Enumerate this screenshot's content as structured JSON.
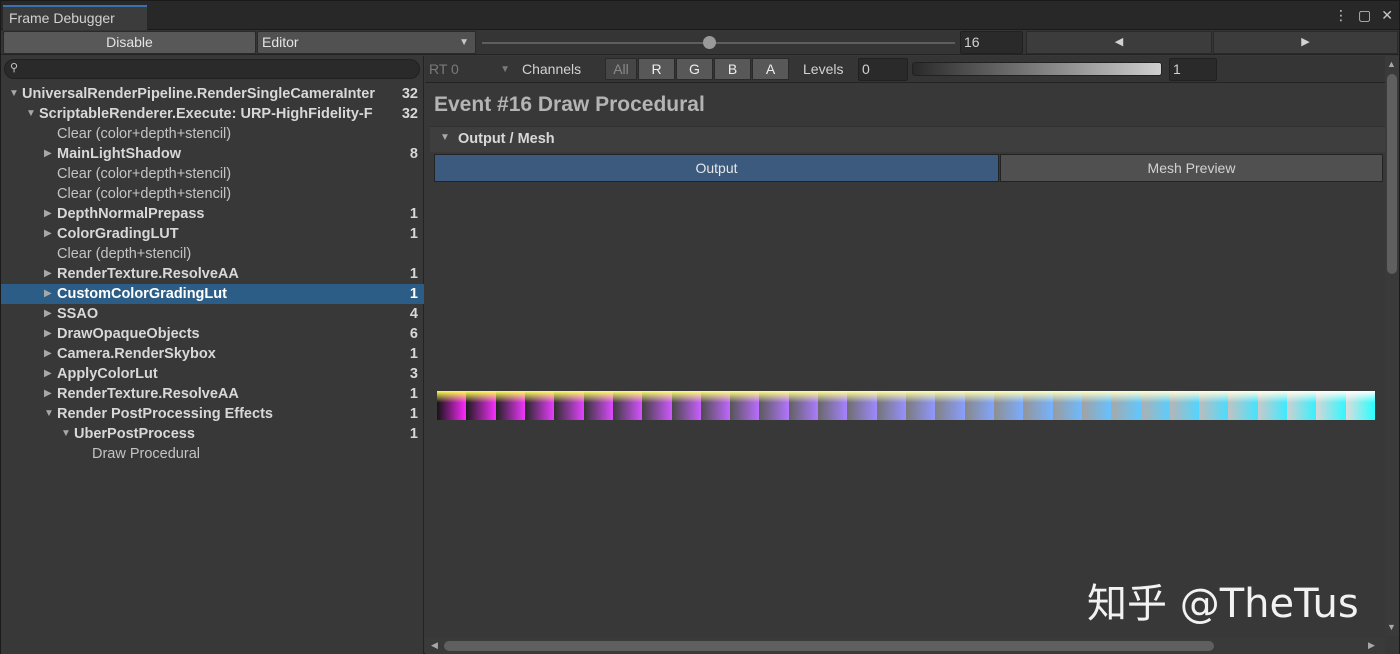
{
  "window": {
    "tab_title": "Frame Debugger",
    "menu_icon": "kebab-menu-icon",
    "maximize_icon": "maximize-icon",
    "close_icon": "close-icon"
  },
  "toolbar": {
    "disable_label": "Disable",
    "target_value": "Editor",
    "event_index": "16",
    "event_slider_fraction": 0.48
  },
  "search": {
    "placeholder": "",
    "icon": "search-icon"
  },
  "tree": [
    {
      "label": "UniversalRenderPipeline.RenderSingleCameraInter",
      "count": "32",
      "depth": 0,
      "expanded": true,
      "bold": true
    },
    {
      "label": "ScriptableRenderer.Execute: URP-HighFidelity-F",
      "count": "32",
      "depth": 1,
      "expanded": true,
      "bold": true
    },
    {
      "label": "Clear (color+depth+stencil)",
      "count": "",
      "depth": 2,
      "leaf": true
    },
    {
      "label": "MainLightShadow",
      "count": "8",
      "depth": 2,
      "expanded": false,
      "bold": true
    },
    {
      "label": "Clear (color+depth+stencil)",
      "count": "",
      "depth": 2,
      "leaf": true
    },
    {
      "label": "Clear (color+depth+stencil)",
      "count": "",
      "depth": 2,
      "leaf": true
    },
    {
      "label": "DepthNormalPrepass",
      "count": "1",
      "depth": 2,
      "expanded": false,
      "bold": true
    },
    {
      "label": "ColorGradingLUT",
      "count": "1",
      "depth": 2,
      "expanded": false,
      "bold": true
    },
    {
      "label": "Clear (depth+stencil)",
      "count": "",
      "depth": 2,
      "leaf": true
    },
    {
      "label": "RenderTexture.ResolveAA",
      "count": "1",
      "depth": 2,
      "expanded": false,
      "bold": true
    },
    {
      "label": "CustomColorGradingLut",
      "count": "1",
      "depth": 2,
      "expanded": false,
      "bold": true,
      "selected": true
    },
    {
      "label": "SSAO",
      "count": "4",
      "depth": 2,
      "expanded": false,
      "bold": true
    },
    {
      "label": "DrawOpaqueObjects",
      "count": "6",
      "depth": 2,
      "expanded": false,
      "bold": true
    },
    {
      "label": "Camera.RenderSkybox",
      "count": "1",
      "depth": 2,
      "expanded": false,
      "bold": true
    },
    {
      "label": "ApplyColorLut",
      "count": "3",
      "depth": 2,
      "expanded": false,
      "bold": true
    },
    {
      "label": "RenderTexture.ResolveAA",
      "count": "1",
      "depth": 2,
      "expanded": false,
      "bold": true
    },
    {
      "label": "Render PostProcessing Effects",
      "count": "1",
      "depth": 2,
      "expanded": true,
      "bold": true
    },
    {
      "label": "UberPostProcess",
      "count": "1",
      "depth": 3,
      "expanded": true,
      "bold": true
    },
    {
      "label": "Draw Procedural",
      "count": "",
      "depth": 4,
      "leaf": true
    }
  ],
  "render_target": {
    "rt_value": "RT 0",
    "channels_label": "Channels",
    "channel_buttons": [
      "All",
      "R",
      "G",
      "B",
      "A"
    ],
    "levels_label": "Levels",
    "levels_min": "0",
    "levels_max": "1"
  },
  "details": {
    "event_title": "Event #16 Draw Procedural",
    "section_label": "Output / Mesh",
    "tab_output": "Output",
    "tab_mesh_preview": "Mesh Preview"
  },
  "watermark": "知乎 @TheTus",
  "colors": {
    "accent": "#2c5d87",
    "tab_highlight": "#3a72b0",
    "output_tab": "#3c5a7e"
  }
}
